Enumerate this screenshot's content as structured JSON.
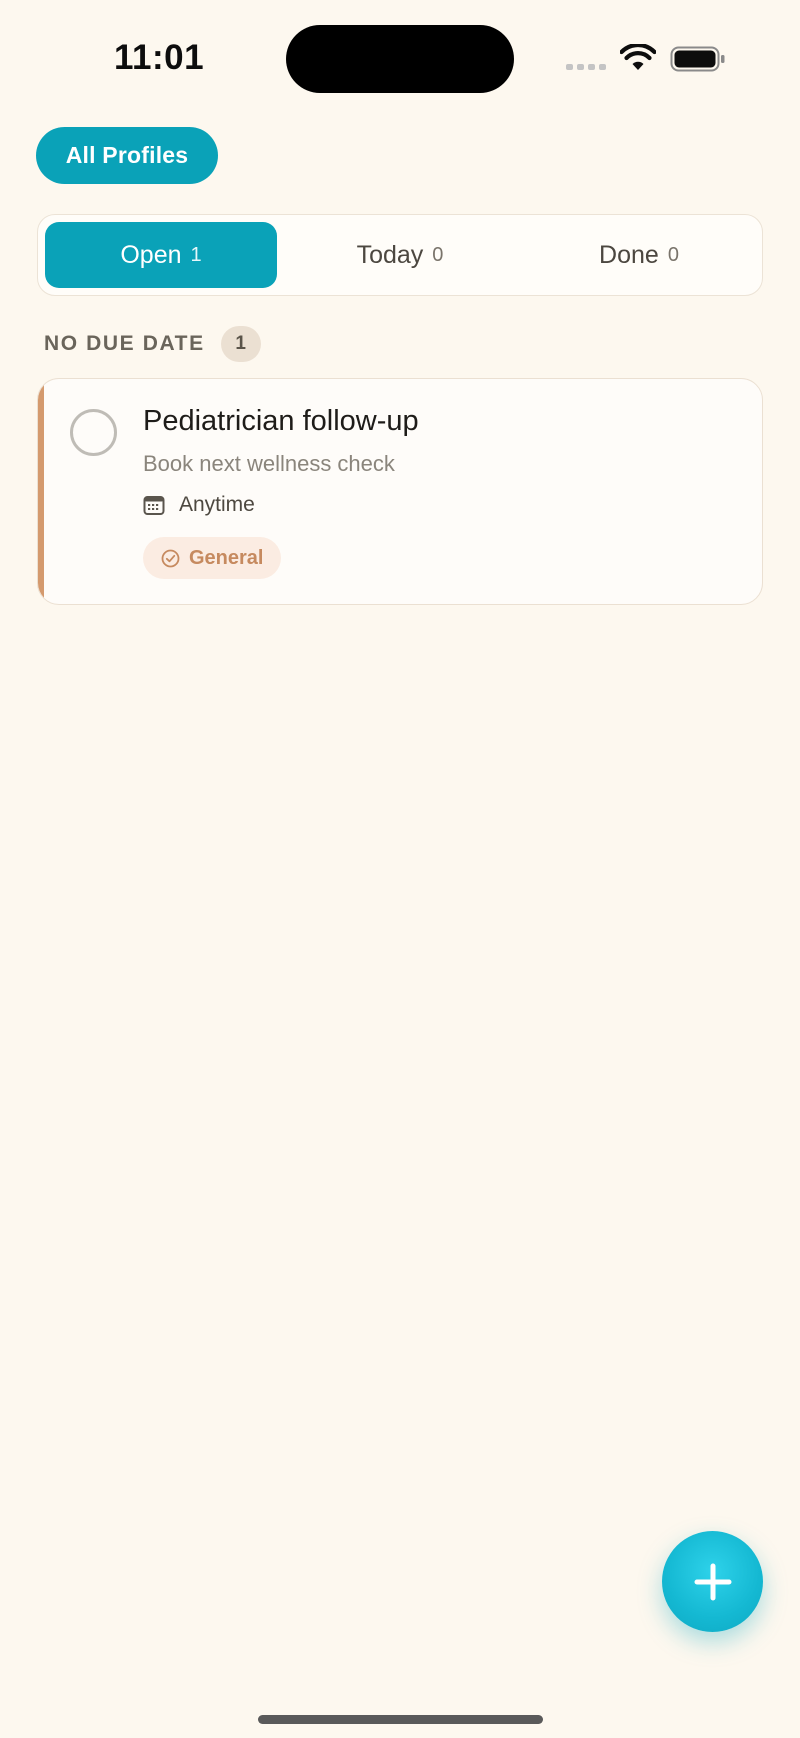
{
  "status_bar": {
    "time": "11:01",
    "icons": [
      "cellular-signal-icon",
      "wifi-icon",
      "battery-icon"
    ]
  },
  "profiles": {
    "label": "All Profiles"
  },
  "tabs": [
    {
      "label": "Open",
      "count": "1",
      "active": true
    },
    {
      "label": "Today",
      "count": "0",
      "active": false
    },
    {
      "label": "Done",
      "count": "0",
      "active": false
    }
  ],
  "section": {
    "title": "NO DUE DATE",
    "count": "1"
  },
  "tasks": [
    {
      "title": "Pediatrician follow-up",
      "subtitle": "Book next wellness check",
      "when": "Anytime",
      "when_icon": "calendar-icon",
      "tag": "General",
      "tag_icon": "check-circle-icon"
    }
  ],
  "fab": {
    "icon": "plus-icon"
  },
  "colors": {
    "background": "#fdf8ef",
    "accent": "#0aa2b8",
    "fab": "#14b8d2",
    "task_accent": "#d49a6e",
    "tag_text": "#c68a5f",
    "tag_bg": "#fbece2"
  }
}
